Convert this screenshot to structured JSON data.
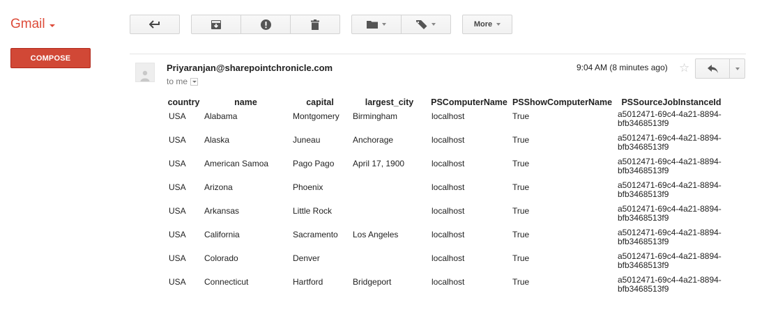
{
  "app": {
    "name": "Gmail"
  },
  "toolbar": {
    "more_label": "More"
  },
  "compose_label": "COMPOSE",
  "message": {
    "sender": "Priyaranjan@sharepointchronicle.com",
    "recipient": "to me",
    "time": "9:04 AM (8 minutes ago)"
  },
  "table": {
    "headers": [
      "country",
      "name",
      "capital",
      "largest_city",
      "PSComputerName",
      "PSShowComputerName",
      "PSSourceJobInstanceId"
    ],
    "rows": [
      [
        "USA",
        "Alabama",
        "Montgomery",
        "Birmingham",
        "localhost",
        "True",
        "a5012471-69c4-4a21-8894-bfb3468513f9"
      ],
      [
        "USA",
        "Alaska",
        "Juneau",
        "Anchorage",
        "localhost",
        "True",
        "a5012471-69c4-4a21-8894-bfb3468513f9"
      ],
      [
        "USA",
        "American Samoa",
        "Pago Pago",
        "April 17, 1900",
        "localhost",
        "True",
        "a5012471-69c4-4a21-8894-bfb3468513f9"
      ],
      [
        "USA",
        "Arizona",
        "Phoenix",
        "",
        "localhost",
        "True",
        "a5012471-69c4-4a21-8894-bfb3468513f9"
      ],
      [
        "USA",
        "Arkansas",
        "Little Rock",
        "",
        "localhost",
        "True",
        "a5012471-69c4-4a21-8894-bfb3468513f9"
      ],
      [
        "USA",
        "California",
        "Sacramento",
        "Los Angeles",
        "localhost",
        "True",
        "a5012471-69c4-4a21-8894-bfb3468513f9"
      ],
      [
        "USA",
        "Colorado",
        "Denver",
        "",
        "localhost",
        "True",
        "a5012471-69c4-4a21-8894-bfb3468513f9"
      ],
      [
        "USA",
        "Connecticut",
        "Hartford",
        "Bridgeport",
        "localhost",
        "True",
        "a5012471-69c4-4a21-8894-bfb3468513f9"
      ]
    ]
  },
  "icons": {
    "back": "arrow-back-icon",
    "archive": "archive-icon",
    "spam": "report-spam-icon",
    "delete": "trash-icon",
    "move": "folder-icon",
    "labels": "label-tag-icon",
    "star": "star-icon",
    "reply": "reply-icon",
    "avatar": "person-icon"
  },
  "colors": {
    "brand": "#dd4b39",
    "compose": "#d14836"
  }
}
